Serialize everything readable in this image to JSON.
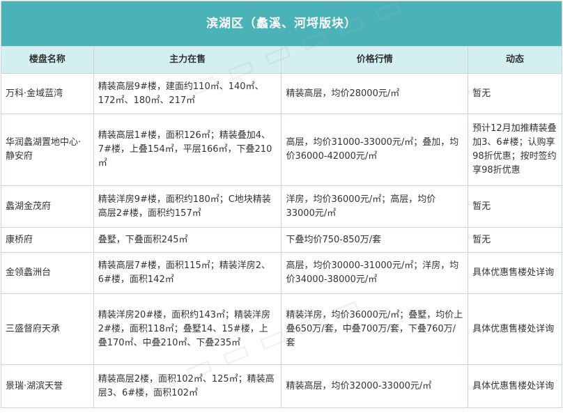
{
  "title": "滨湖区（蠡溪、河埒版块）",
  "headers": [
    "楼盘名称",
    "主力在售",
    "价格行情",
    "动态"
  ],
  "rows": [
    {
      "name": "万科·金域蓝湾",
      "sale": "精装高层9#楼，建面约110㎡、140㎡、172㎡、180㎡、217㎡",
      "price": "精装高层，均价28000元/㎡",
      "status": "暂无"
    },
    {
      "name": "华润蠡湖置地中心·静安府",
      "sale": "精装高层1#楼，面积126㎡；精装叠加4、7#楼，上叠154㎡，平层166㎡，下叠210㎡",
      "price": "高层，均价31000-33000元/㎡；叠加，均价36000-42000元/㎡",
      "status": "预计12月加推精装叠加3、6#楼；认购享98折优惠；按时签约享98折优惠"
    },
    {
      "name": "蠡湖金茂府",
      "sale": "精装洋房9#楼，面积约180㎡；C地块精装高层2#楼，面积约157㎡",
      "price": "洋房，均价36000元/㎡；高层，均价33000元/㎡",
      "status": "暂无"
    },
    {
      "name": "康桥府",
      "sale": "叠墅，下叠面积245㎡",
      "price": "下叠均价750-850万/套",
      "status": "暂无"
    },
    {
      "name": "金领蠡洲台",
      "sale": "精装高层7#楼，面积115㎡；精装洋房2、6#楼，面积142㎡",
      "price": "高层，均价30000-31000元/㎡；洋房，均价34000-38000元/㎡",
      "status": "具体优惠售楼处详询"
    },
    {
      "name": "三盛督府天承",
      "sale": "精装洋房20#楼，面积约143㎡；精装洋房2#楼，面积118㎡；叠墅14、15#楼，上叠170㎡、中叠210㎡、下叠235㎡",
      "price": "精装洋房，均价36000元/㎡；叠墅，均价上叠650万/套，中叠700万/套，下叠760万/套",
      "status": "具体优惠售楼处详询"
    },
    {
      "name": "景瑞·湖滨天誉",
      "sale": "精装高层2楼，面积102㎡、125㎡；精装高层3、6#楼，面积102㎡",
      "price": "精装高层，均价32000-33000元/㎡",
      "status": "具体优惠售楼处详询"
    }
  ],
  "colors": {
    "title_bg": "#4bb2b8",
    "header_bg": "#d4eff0",
    "border": "#c9d6d6",
    "text": "#333333"
  }
}
